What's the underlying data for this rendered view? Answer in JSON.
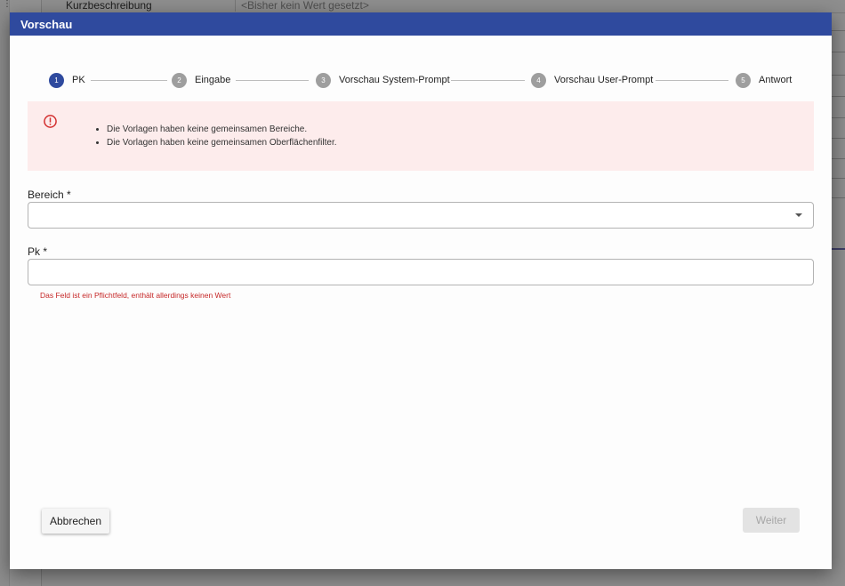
{
  "background": {
    "row_label": "Kurzbeschreibung",
    "row_value": "<Bisher kein Wert gesetzt>"
  },
  "dialog": {
    "title": "Vorschau"
  },
  "stepper": {
    "steps": [
      {
        "number": "1",
        "label": "PK",
        "active": true
      },
      {
        "number": "2",
        "label": "Eingabe",
        "active": false
      },
      {
        "number": "3",
        "label": "Vorschau System-Prompt",
        "active": false
      },
      {
        "number": "4",
        "label": "Vorschau User-Prompt",
        "active": false
      },
      {
        "number": "5",
        "label": "Antwort",
        "active": false
      }
    ]
  },
  "alert": {
    "icon": "error-circle-icon",
    "color": "#fdecec",
    "messages": [
      "Die Vorlagen haben keine gemeinsamen Bereiche.",
      "Die Vorlagen haben keine gemeinsamen Oberflächenfilter."
    ]
  },
  "form": {
    "bereich_label": "Bereich *",
    "bereich_value": "",
    "pk_label": "Pk *",
    "pk_value": "",
    "pk_error": "Das Feld ist ein Pflichtfeld, enthält allerdings keinen Wert"
  },
  "buttons": {
    "cancel": "Abbrechen",
    "next": "Weiter",
    "next_disabled": true
  },
  "colors": {
    "header": "#2f4a9e",
    "active_step": "#2f4a9e",
    "error_text": "#c62828"
  }
}
